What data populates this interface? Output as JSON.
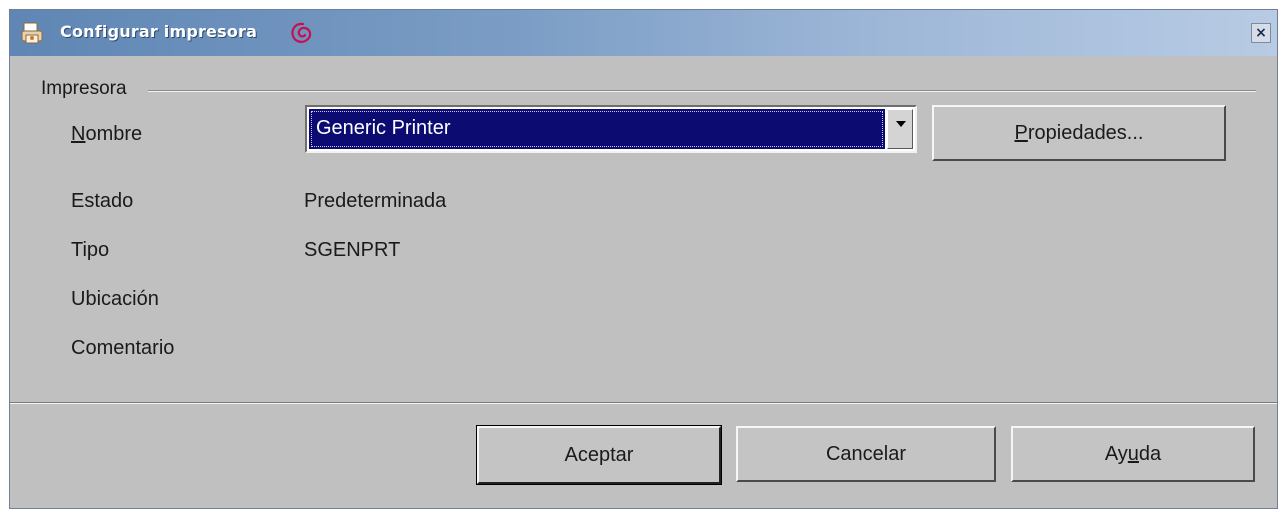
{
  "window": {
    "title": "Configurar impresora",
    "icons": {
      "app": "printer-icon",
      "branding": "debian-swirl-icon",
      "close": "close-icon"
    },
    "close_label": "×"
  },
  "printer_group": {
    "label": "Impresora",
    "name_label_prefix": "",
    "name_label_mnemonic": "N",
    "name_label_rest": "ombre",
    "name_value": "Generic Printer",
    "properties_mnemonic": "P",
    "properties_rest": "ropiedades...",
    "status_label": "Estado",
    "status_value": "Predeterminada",
    "type_label": "Tipo",
    "type_value": "SGENPRT",
    "location_label": "Ubicación",
    "location_value": "",
    "comment_label": "Comentario",
    "comment_value": ""
  },
  "buttons": {
    "ok": "Aceptar",
    "cancel": "Cancelar",
    "help_prefix": "Ay",
    "help_mnemonic": "u",
    "help_rest": "da"
  },
  "colors": {
    "selection": "#0b0b72",
    "dialog_bg": "#c0c0c0",
    "titlebar": "#5f86b4"
  }
}
